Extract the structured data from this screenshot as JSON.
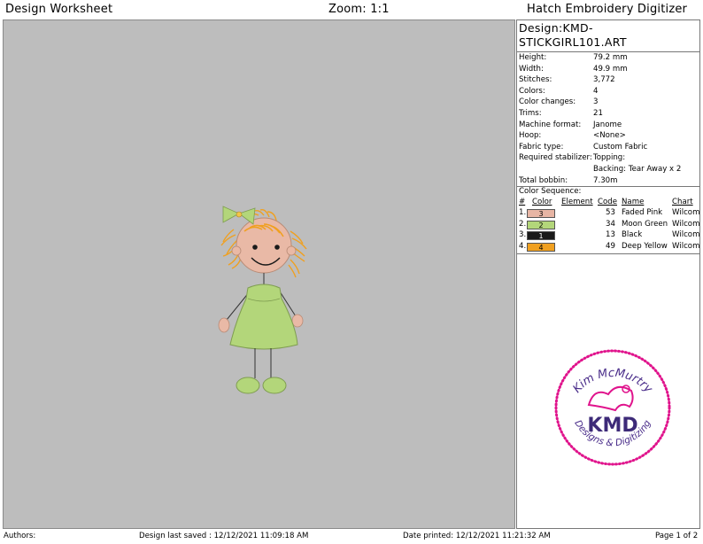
{
  "header": {
    "left": "Design Worksheet",
    "center": "Zoom:  1:1",
    "right": "Hatch Embroidery Digitizer"
  },
  "design": {
    "title_line1": "Design:KMD-",
    "title_line2": "STICKGIRL101.ART",
    "props": [
      {
        "k": "Height:",
        "v": "79.2 mm"
      },
      {
        "k": "Width:",
        "v": "49.9 mm"
      },
      {
        "k": "Stitches:",
        "v": "3,772"
      },
      {
        "k": "Colors:",
        "v": "4"
      },
      {
        "k": "Color changes:",
        "v": "3"
      },
      {
        "k": "Trims:",
        "v": "21"
      },
      {
        "k": "Machine format:",
        "v": "Janome"
      },
      {
        "k": "Hoop:",
        "v": "<None>"
      },
      {
        "k": "Fabric type:",
        "v": "Custom Fabric"
      },
      {
        "k": "Required stabilizer:",
        "v": "Topping:"
      },
      {
        "k": "",
        "v": "Backing: Tear Away x 2"
      },
      {
        "k": "Total bobbin:",
        "v": "7.30m"
      }
    ]
  },
  "sequence": {
    "title": "Color Sequence:",
    "headers": {
      "num": "#",
      "color": "Color",
      "element": "Element",
      "code": "Code",
      "name": "Name",
      "chart": "Chart"
    },
    "rows": [
      {
        "num": "1.",
        "swatch": "3",
        "code": "53",
        "name": "Faded Pink",
        "chart": "Wilcom",
        "color": "#e7b5a4"
      },
      {
        "num": "2.",
        "swatch": "2",
        "code": "34",
        "name": "Moon Green",
        "chart": "Wilcom",
        "color": "#b3d67a"
      },
      {
        "num": "3.",
        "swatch": "1",
        "code": "13",
        "name": "Black",
        "chart": "Wilcom",
        "color": "#1a1a1a"
      },
      {
        "num": "4.",
        "swatch": "4",
        "code": "49",
        "name": "Deep Yellow",
        "chart": "Wilcom",
        "color": "#f0a020"
      }
    ]
  },
  "logo": {
    "arc_text": "Kim McMurtry",
    "brand": "KMD",
    "bottom_text": "Designs & Digitizing"
  },
  "footer": {
    "authors": "Authors:",
    "saved": "Design last saved : 12/12/2021 11:09:18 AM",
    "printed": "Date printed: 12/12/2021 11:21:32 AM",
    "page": "Page 1 of 2"
  }
}
